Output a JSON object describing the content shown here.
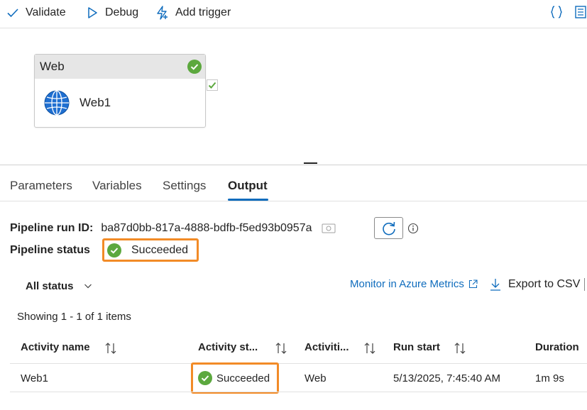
{
  "toolbar": {
    "validate_label": "Validate",
    "debug_label": "Debug",
    "add_trigger_label": "Add trigger",
    "code_icon": "braces-icon",
    "properties_icon": "properties-icon"
  },
  "canvas": {
    "activity": {
      "type_label": "Web",
      "name": "Web1",
      "status_icon": "success-check-icon",
      "activity_icon": "globe-icon"
    }
  },
  "tabs": [
    {
      "label": "Parameters",
      "active": false
    },
    {
      "label": "Variables",
      "active": false
    },
    {
      "label": "Settings",
      "active": false
    },
    {
      "label": "Output",
      "active": true
    }
  ],
  "output": {
    "run_id_label": "Pipeline run ID:",
    "run_id": "ba87d0bb-817a-4888-bdfb-f5ed93b0957a",
    "status_label": "Pipeline status",
    "status": "Succeeded",
    "filter_label": "All status",
    "monitor_link": "Monitor in Azure Metrics",
    "export_label": "Export to CSV",
    "showing_text": "Showing 1 - 1 of 1 items",
    "columns": [
      "Activity name",
      "Activity st...",
      "Activiti...",
      "Run start",
      "Duration"
    ],
    "rows": [
      {
        "activity_name": "Web1",
        "activity_status": "Succeeded",
        "activity_type": "Web",
        "run_start": "5/13/2025, 7:45:40 AM",
        "duration": "1m 9s"
      }
    ]
  },
  "colors": {
    "accent": "#0f6cbd",
    "success": "#5ca83e",
    "highlight": "#f28b27"
  }
}
